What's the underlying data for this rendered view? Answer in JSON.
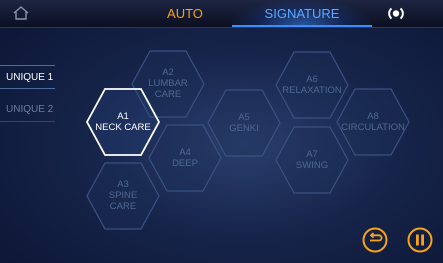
{
  "header": {
    "tabs": [
      {
        "label": "AUTO",
        "color": "#f6a21a"
      },
      {
        "label": "SIGNATURE",
        "color": "#5fa8ff",
        "selected": true
      }
    ]
  },
  "sidebar": {
    "items": [
      {
        "label": "UNIQUE 1",
        "selected": true
      },
      {
        "label": "UNIQUE 2",
        "selected": false
      }
    ]
  },
  "programs": [
    {
      "code": "A1",
      "line1": "NECK CARE",
      "line2": "",
      "selected": true
    },
    {
      "code": "A2",
      "line1": "LUMBAR",
      "line2": "CARE",
      "selected": false
    },
    {
      "code": "A3",
      "line1": "SPINE",
      "line2": "CARE",
      "selected": false
    },
    {
      "code": "A4",
      "line1": "DEEP",
      "line2": "",
      "selected": false
    },
    {
      "code": "A5",
      "line1": "GENKI",
      "line2": "",
      "selected": false
    },
    {
      "code": "A6",
      "line1": "RELAXATION",
      "line2": "",
      "selected": false
    },
    {
      "code": "A7",
      "line1": "SWING",
      "line2": "",
      "selected": false
    },
    {
      "code": "A8",
      "line1": "CIRCULATION",
      "line2": "",
      "selected": false
    }
  ],
  "icons": {
    "home": "home-icon",
    "audio": "audio-icon",
    "back": "back-icon",
    "pause": "pause-icon"
  },
  "colors": {
    "accent": "#f6a21a",
    "selected_tab": "#5fa8ff",
    "hex_inactive": "#4f6892",
    "hex_active": "#ffffff"
  }
}
